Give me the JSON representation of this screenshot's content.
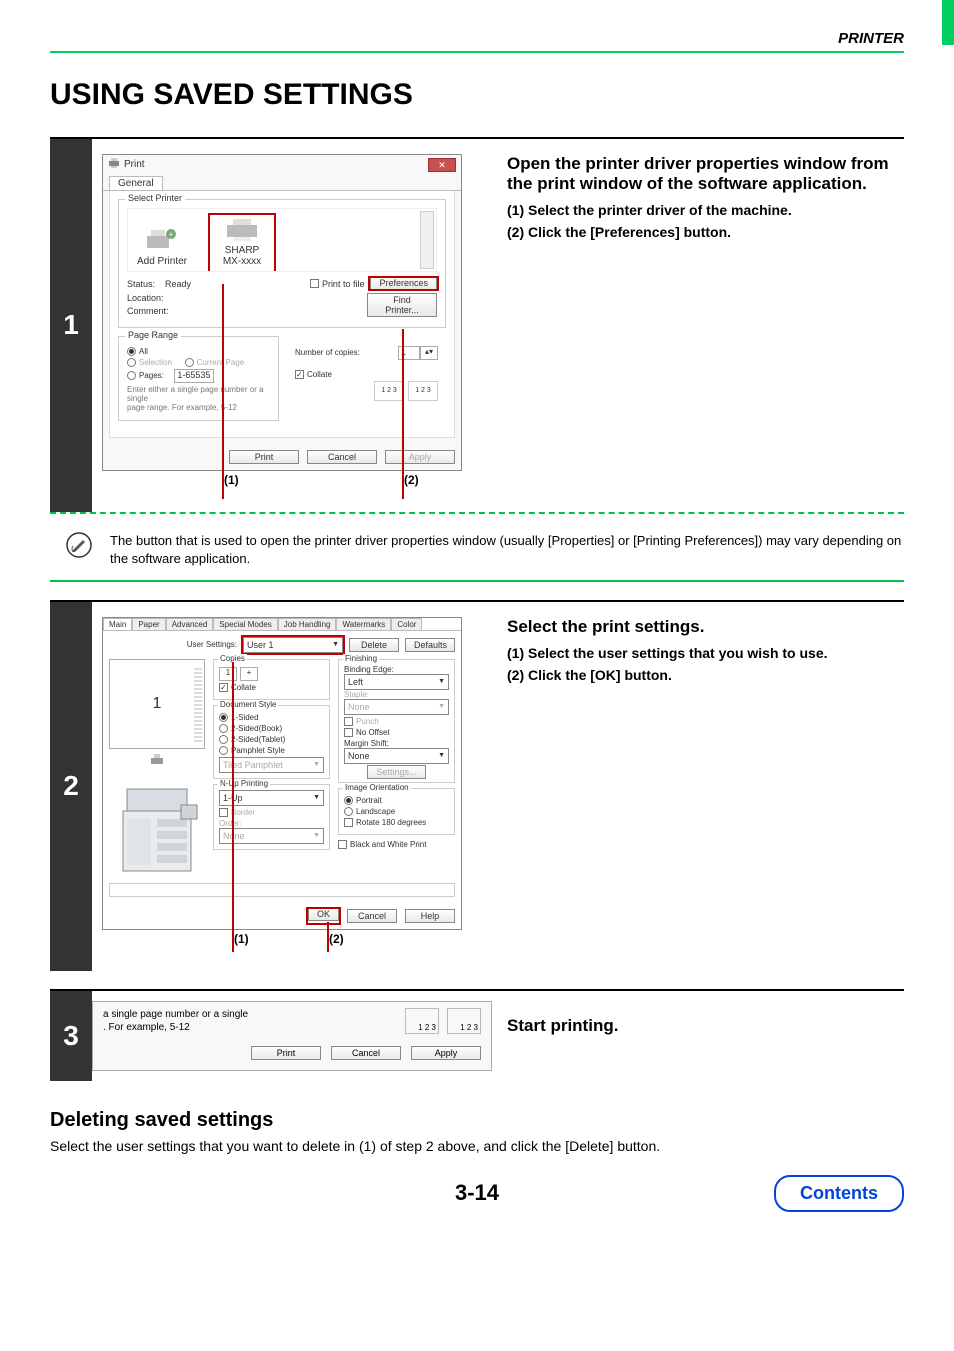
{
  "header": {
    "category": "PRINTER"
  },
  "title": "USING SAVED SETTINGS",
  "step1": {
    "num": "1",
    "heading": "Open the printer driver properties window from the print window of the software application.",
    "items": [
      "(1)  Select the printer driver of the machine.",
      "(2)  Click the [Preferences] button."
    ],
    "callout1": "(1)",
    "callout2": "(2)",
    "dialog": {
      "title": "Print",
      "tab": "General",
      "selectPrinterLegend": "Select Printer",
      "addPrinter": "Add Printer",
      "sharp": "SHARP",
      "sharpModel": "MX-xxxx",
      "statusLabel": "Status:",
      "statusVal": "Ready",
      "locationLabel": "Location:",
      "commentLabel": "Comment:",
      "printToFile": "Print to file",
      "preferences": "Preferences",
      "findPrinter": "Find Printer...",
      "pageRangeLegend": "Page Range",
      "all": "All",
      "selection": "Selection",
      "currentPage": "Current Page",
      "pages": "Pages:",
      "pagesVal": "1-65535",
      "pagesHelp1": "Enter either a single page number or a single",
      "pagesHelp2": "page range.  For example, 5-12",
      "copiesLabel": "Number of copies:",
      "copiesVal": "1",
      "collate": "Collate",
      "collateIllu": "1 2 3",
      "btnPrint": "Print",
      "btnCancel": "Cancel",
      "btnApply": "Apply"
    }
  },
  "note1": "The button that is used to open the printer driver properties window (usually [Properties] or [Printing Preferences]) may vary depending on the software application.",
  "step2": {
    "num": "2",
    "heading": "Select the print settings.",
    "items": [
      "(1)  Select the user settings that you wish to use.",
      "(2)  Click the [OK] button."
    ],
    "callout1": "(1)",
    "callout2": "(2)",
    "dialog": {
      "tabs": [
        "Main",
        "Paper",
        "Advanced",
        "Special Modes",
        "Job Handling",
        "Watermarks",
        "Color"
      ],
      "userSettingsLabel": "User Settings:",
      "userSettingsVal": "User 1",
      "deleteBtn": "Delete",
      "defaultsBtn": "Defaults",
      "previewNum": "1",
      "copiesLegend": "Copies",
      "copiesVal": "1",
      "collate": "Collate",
      "docStyleLegend": "Document Style",
      "oneSided": "1-Sided",
      "twoSidedBook": "2-Sided(Book)",
      "twoSidedTablet": "2-Sided(Tablet)",
      "pamphlet": "Pamphlet Style",
      "tiledPamphlet": "Tiled Pamphlet",
      "nupLegend": "N-Up Printing",
      "nupVal": "1-Up",
      "border": "Border",
      "orderLabel": "Order:",
      "orderVal": "None",
      "finishingLegend": "Finishing",
      "bindingLabel": "Binding Edge:",
      "bindingVal": "Left",
      "stapleLabel": "Staple:",
      "stapleVal": "None",
      "punch": "Punch",
      "noOffset": "No Offset",
      "marginLabel": "Margin Shift:",
      "marginVal": "None",
      "settingsBtn": "Settings...",
      "orientLegend": "Image Orientation",
      "portrait": "Portrait",
      "landscape": "Landscape",
      "rotate": "Rotate 180 degrees",
      "bw": "Black and White Print",
      "ok": "OK",
      "cancel": "Cancel",
      "help": "Help"
    }
  },
  "step3": {
    "num": "3",
    "heading": "Start printing.",
    "dialog": {
      "helpLine1": "a single page number or a single",
      "helpLine2": ".  For example, 5-12",
      "collateIllu": "1 2 3",
      "btnPrint": "Print",
      "btnCancel": "Cancel",
      "btnApply": "Apply"
    }
  },
  "subsection": {
    "title": "Deleting saved settings",
    "text": "Select the user settings that you want to delete in (1) of step 2 above, and click the [Delete] button."
  },
  "pageNum": "3-14",
  "contents": "Contents"
}
